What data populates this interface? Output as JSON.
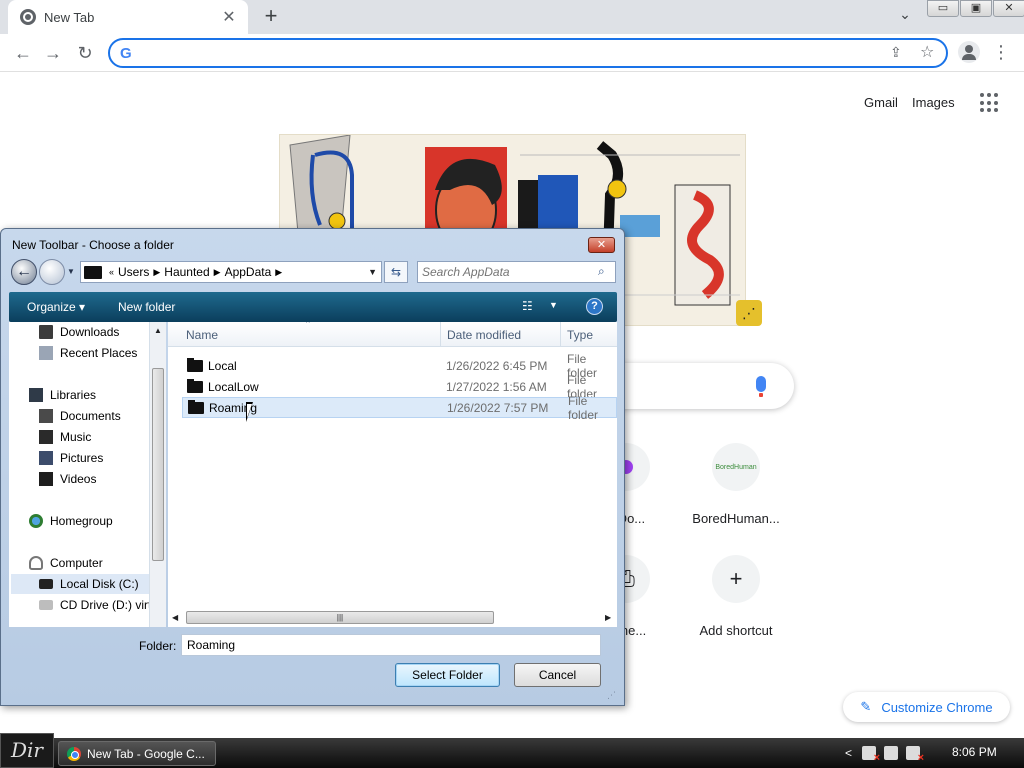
{
  "browser": {
    "tab_title": "New Tab",
    "tab_close": "✕",
    "new_tab": "+",
    "omnibox_value": "",
    "window_controls": [
      "▭",
      "▣",
      "✕"
    ]
  },
  "ntp": {
    "gmail": "Gmail",
    "images": "Images",
    "shortcuts": [
      {
        "label": "e Do..."
      },
      {
        "label": "BoredHuman..."
      },
      {
        "label": "terne..."
      },
      {
        "label": "Add shortcut",
        "glyph": "+"
      }
    ],
    "bored_favicon_text": "BoredHuman",
    "customize_label": "Customize Chrome"
  },
  "dialog": {
    "title": "New Toolbar - Choose a folder",
    "breadcrumbs": [
      "Users",
      "Haunted",
      "AppData"
    ],
    "search_placeholder": "Search AppData",
    "organize": "Organize",
    "new_folder": "New folder",
    "nav_items": [
      {
        "label": "Downloads"
      },
      {
        "label": "Recent Places"
      },
      {
        "label": "Libraries"
      },
      {
        "label": "Documents"
      },
      {
        "label": "Music"
      },
      {
        "label": "Pictures"
      },
      {
        "label": "Videos"
      },
      {
        "label": "Homegroup"
      },
      {
        "label": "Computer"
      },
      {
        "label": "Local Disk (C:)"
      },
      {
        "label": "CD Drive (D:) virt"
      }
    ],
    "columns": {
      "name": "Name",
      "date": "Date modified",
      "type": "Type"
    },
    "files": [
      {
        "name": "Local",
        "date": "1/26/2022 6:45 PM",
        "type": "File folder"
      },
      {
        "name": "LocalLow",
        "date": "1/27/2022 1:56 AM",
        "type": "File folder"
      },
      {
        "name": "Roaming",
        "date": "1/26/2022 7:57 PM",
        "type": "File folder"
      }
    ],
    "folder_label": "Folder:",
    "folder_value": "Roaming",
    "select_button": "Select Folder",
    "cancel_button": "Cancel"
  },
  "taskbar": {
    "start_label": "Dir",
    "task_label": "New Tab - Google C...",
    "clock": "8:06 PM"
  },
  "colors": {
    "chrome_accent": "#1a73e8",
    "doodle_share_bg": "#e5c02c",
    "dialog_cmdbar": "#0b3e5c"
  }
}
